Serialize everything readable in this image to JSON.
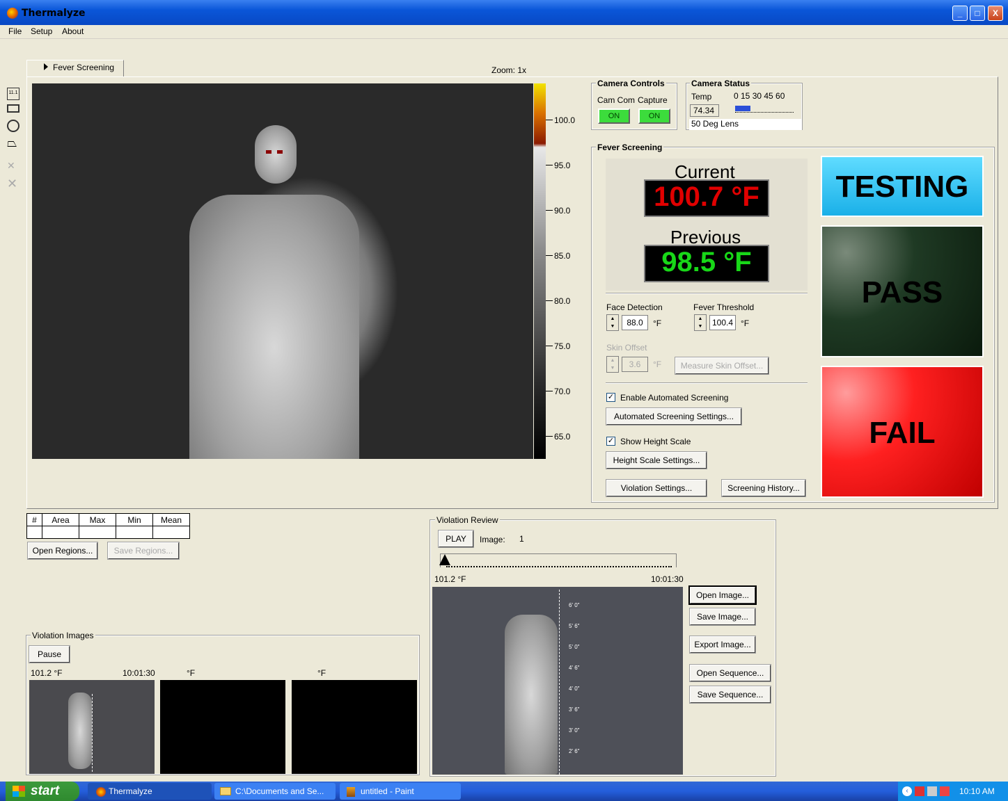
{
  "window": {
    "title": "Thermalyze",
    "controls": [
      "_",
      "□",
      "X"
    ]
  },
  "menu": [
    "File",
    "Setup",
    "About"
  ],
  "tab": {
    "label": "Fever Screening"
  },
  "zoom": "Zoom: 1x",
  "scale": [
    "100.0",
    "95.0",
    "90.0",
    "85.0",
    "80.0",
    "75.0",
    "70.0",
    "65.0"
  ],
  "camera_controls": {
    "title": "Camera Controls",
    "cam_com_label": "Cam Com",
    "capture_label": "Capture",
    "cam_com_state": "ON",
    "capture_state": "ON"
  },
  "camera_status": {
    "title": "Camera Status",
    "temp_label": "Temp",
    "temp_value": "74.34",
    "scale_labels": "0  15  30  45  60",
    "lens": "50 Deg Lens"
  },
  "fever": {
    "title": "Fever Screening",
    "current_label": "Current",
    "current_value": "100.7 °F",
    "previous_label": "Previous",
    "previous_value": "98.5 °F",
    "face_detection_label": "Face Detection",
    "face_detection_value": "88.0",
    "face_unit": "°F",
    "fever_threshold_label": "Fever Threshold",
    "fever_threshold_value": "100.4",
    "threshold_unit": "°F",
    "skin_offset_label": "Skin Offset",
    "skin_offset_value": "3.6",
    "skin_unit": "°F",
    "measure_skin_offset": "Measure Skin Offset...",
    "enable_auto": "Enable Automated Screening",
    "auto_settings": "Automated Screening Settings...",
    "show_height": "Show Height Scale",
    "height_settings": "Height Scale Settings...",
    "violation_settings": "Violation Settings...",
    "screening_history": "Screening History...",
    "status_testing": "TESTING",
    "status_pass": "PASS",
    "status_fail": "FAIL"
  },
  "regions": {
    "headers": [
      "#",
      "Area",
      "Max",
      "Min",
      "Mean"
    ],
    "open": "Open Regions...",
    "save": "Save Regions..."
  },
  "violation_images": {
    "title": "Violation Images",
    "pause": "Pause",
    "img1_temp": "101.2 °F",
    "img1_time": "10:01:30",
    "img2_temp": "°F",
    "img3_temp": "°F"
  },
  "violation_review": {
    "title": "Violation Review",
    "play": "PLAY",
    "image_label": "Image:",
    "image_num": "1",
    "temp": "101.2 °F",
    "time": "10:01:30",
    "open_image": "Open Image...",
    "save_image": "Save Image...",
    "export_image": "Export Image...",
    "open_sequence": "Open Sequence...",
    "save_sequence": "Save Sequence...",
    "heights": [
      "6' 0\"",
      "5' 6\"",
      "5' 0\"",
      "4' 6\"",
      "4' 0\"",
      "3' 6\"",
      "3' 0\"",
      "2' 6\""
    ]
  },
  "taskbar": {
    "start": "start",
    "tasks": [
      "Thermalyze",
      "C:\\Documents and Se...",
      "untitled - Paint"
    ],
    "clock": "10:10 AM"
  }
}
